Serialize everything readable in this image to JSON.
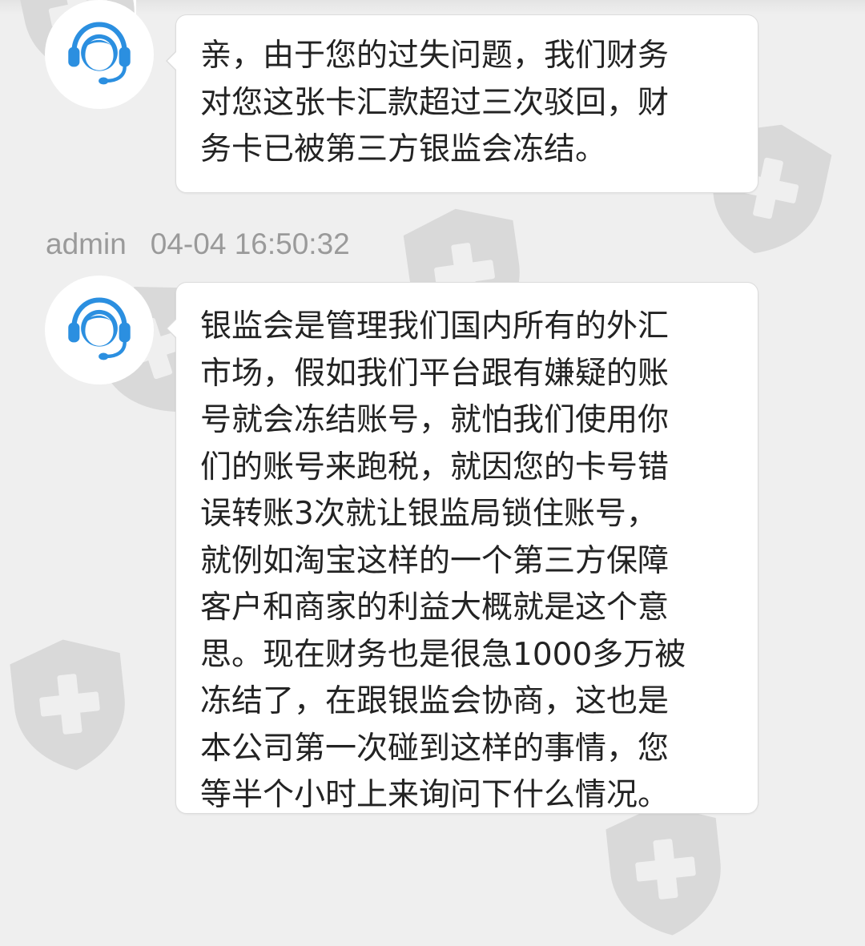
{
  "icons": {
    "watermark": "shield-plus-icon",
    "agent_avatar": "customer-service-headset-icon",
    "previous_avatar": "user-avatar-icon"
  },
  "colors": {
    "background": "#efefef",
    "bubble_background": "#ffffff",
    "bubble_border": "#dcdcdc",
    "message_text": "#232323",
    "meta_text": "#9a9a9a",
    "avatar_blue": "#2b8fe0",
    "watermark": "#d9d9d9"
  },
  "messages": [
    {
      "text": "亲，由于您的过失问题，我们财务\n对您这张卡汇款超过三次驳回，财\n务卡已被第三方银监会冻结。"
    },
    {
      "sender": "admin",
      "timestamp": "04-04 16:50:32",
      "text": "银监会是管理我们国内所有的外汇\n市场，假如我们平台跟有嫌疑的账\n号就会冻结账号，就怕我们使用你\n们的账号来跑税，就因您的卡号错\n误转账3次就让银监局锁住账号，\n就例如淘宝这样的一个第三方保障\n客户和商家的利益大概就是这个意\n思。现在财务也是很急1000多万被\n冻结了，在跟银监会协商，这也是\n本公司第一次碰到这样的事情，您\n等半个小时上来询问下什么情况。"
    }
  ]
}
